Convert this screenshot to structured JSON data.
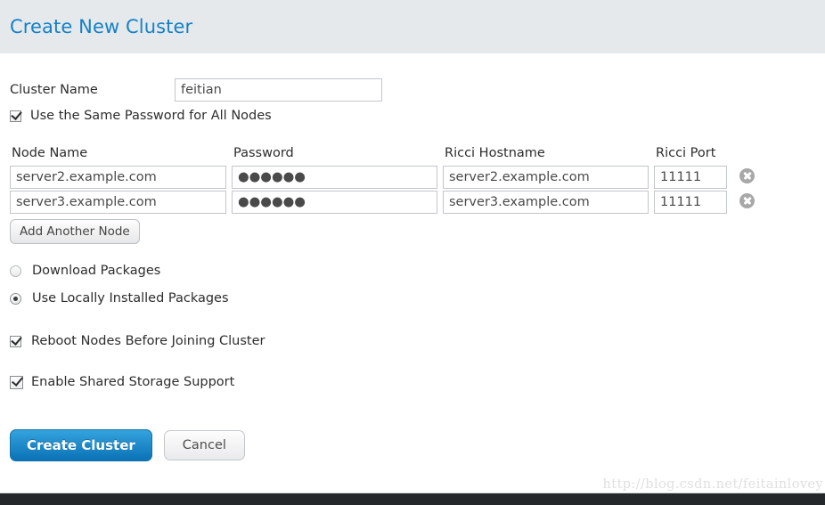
{
  "header": {
    "title": "Create New Cluster"
  },
  "form": {
    "cluster_name_label": "Cluster Name",
    "cluster_name_value": "feitian",
    "cluster_name_placeholder": "",
    "same_password_label": "Use the Same Password for All Nodes",
    "same_password_checked": true
  },
  "nodes_table": {
    "columns": [
      "Node Name",
      "Password",
      "Ricci Hostname",
      "Ricci Port"
    ],
    "rows": [
      {
        "node_name": "server2.example.com",
        "password": "●●●●●●",
        "ricci_hostname": "server2.example.com",
        "ricci_port": "11111",
        "delete_icon": "delete-circle-icon"
      },
      {
        "node_name": "server3.example.com",
        "password": "●●●●●●",
        "ricci_hostname": "server3.example.com",
        "ricci_port": "11111",
        "delete_icon": "delete-circle-icon"
      }
    ],
    "add_node_label": "Add Another Node"
  },
  "package_options": {
    "download_label": "Download Packages",
    "download_selected": false,
    "local_label": "Use Locally Installed Packages",
    "local_selected": true
  },
  "options": {
    "reboot_label": "Reboot Nodes Before Joining Cluster",
    "reboot_checked": true,
    "shared_storage_label": "Enable Shared Storage Support",
    "shared_storage_checked": true
  },
  "actions": {
    "create_label": "Create Cluster",
    "cancel_label": "Cancel"
  },
  "watermark": {
    "text": "http://blog.csdn.net/feitainlovey"
  },
  "colors": {
    "header_bg": "#e5e9ec",
    "title_blue": "#1581c6",
    "primary_button": "#1a8fd0",
    "footer_bar": "#25282b"
  }
}
